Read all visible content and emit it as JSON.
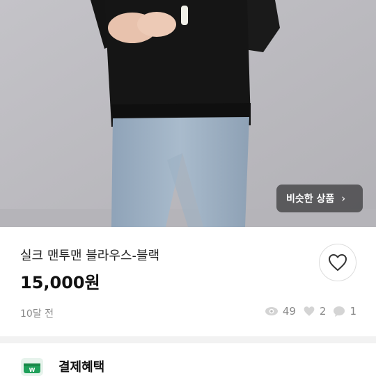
{
  "product": {
    "similar_button_label": "비슷한 상품",
    "title": "실크 맨투맨 블라우스-블랙",
    "price": "15,000원",
    "posted_time": "10달 전",
    "stats": {
      "views": "49",
      "likes": "2",
      "chats": "1"
    }
  },
  "payment": {
    "label": "결제혜택",
    "icon": "wallet-icon",
    "accent": "#1fa05a"
  },
  "icons": {
    "chevron": "›",
    "heart": "heart-outline-icon",
    "eye": "eye-icon",
    "chat": "chat-bubble-icon"
  }
}
